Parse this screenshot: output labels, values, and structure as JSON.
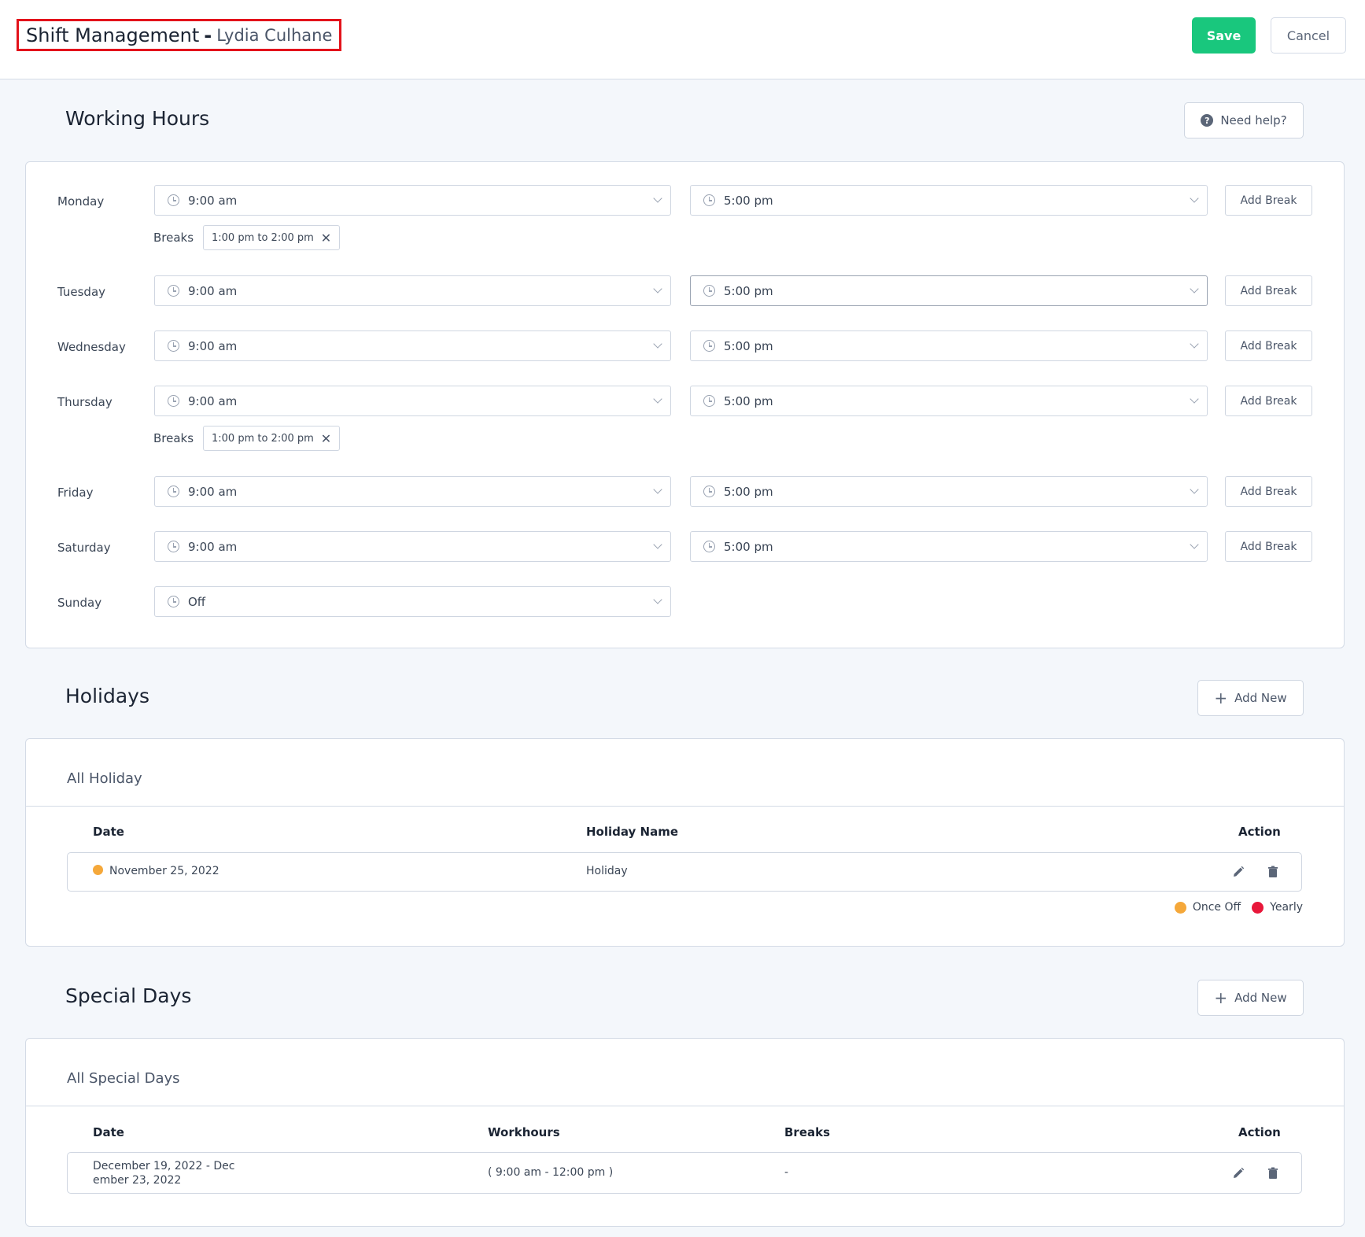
{
  "header": {
    "title": "Shift Management",
    "separator": "-",
    "employee": "Lydia Culhane",
    "save_label": "Save",
    "cancel_label": "Cancel"
  },
  "working_hours": {
    "title": "Working Hours",
    "help_label": "Need help?",
    "add_break_label": "Add Break",
    "breaks_label": "Breaks",
    "days": [
      {
        "day": "Monday",
        "start": "9:00 am",
        "end": "5:00 pm",
        "breaks": [
          "1:00 pm to 2:00 pm"
        ]
      },
      {
        "day": "Tuesday",
        "start": "9:00 am",
        "end": "5:00 pm",
        "breaks": []
      },
      {
        "day": "Wednesday",
        "start": "9:00 am",
        "end": "5:00 pm",
        "breaks": []
      },
      {
        "day": "Thursday",
        "start": "9:00 am",
        "end": "5:00 pm",
        "breaks": [
          "1:00 pm to 2:00 pm"
        ]
      },
      {
        "day": "Friday",
        "start": "9:00 am",
        "end": "5:00 pm",
        "breaks": []
      },
      {
        "day": "Saturday",
        "start": "9:00 am",
        "end": "5:00 pm",
        "breaks": []
      },
      {
        "day": "Sunday",
        "start": "Off",
        "end": null,
        "breaks": []
      }
    ]
  },
  "holidays": {
    "title": "Holidays",
    "add_label": "Add New",
    "card_title": "All Holiday",
    "columns": [
      "Date",
      "Holiday Name",
      "Action"
    ],
    "rows": [
      {
        "date": "November 25, 2022",
        "name": "Holiday",
        "type": "once-off"
      }
    ],
    "legend": [
      {
        "label": "Once Off",
        "color": "#f5a83a"
      },
      {
        "label": "Yearly",
        "color": "#e8173a"
      }
    ]
  },
  "special_days": {
    "title": "Special Days",
    "add_label": "Add New",
    "card_title": "All Special Days",
    "columns": [
      "Date",
      "Workhours",
      "Breaks",
      "Action"
    ],
    "rows": [
      {
        "date_line1": "December 19, 2022 - Dec",
        "date_line2": "ember 23, 2022",
        "workhours": "( 9:00 am - 12:00 pm )",
        "breaks": "-"
      }
    ]
  },
  "colors": {
    "accent": "#19c77d",
    "highlight_border": "#e3121b",
    "once_off": "#f5a83a",
    "yearly": "#e8173a"
  }
}
